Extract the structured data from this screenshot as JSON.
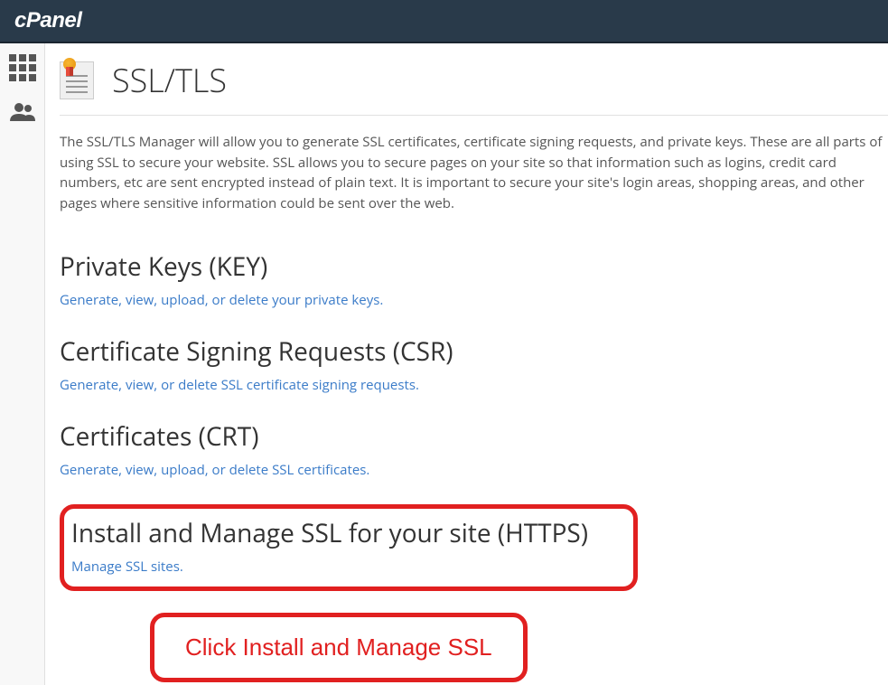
{
  "header": {
    "logo": "cPanel"
  },
  "page": {
    "title": "SSL/TLS",
    "description": "The SSL/TLS Manager will allow you to generate SSL certificates, certificate signing requests, and private keys. These are all parts of using SSL to secure your website. SSL allows you to secure pages on your site so that information such as logins, credit card numbers, etc are sent encrypted instead of plain text. It is important to secure your site's login areas, shopping areas, and other pages where sensitive information could be sent over the web."
  },
  "sections": {
    "privatekeys": {
      "title": "Private Keys (KEY)",
      "link": "Generate, view, upload, or delete your private keys."
    },
    "csr": {
      "title": "Certificate Signing Requests (CSR)",
      "link": "Generate, view, or delete SSL certificate signing requests."
    },
    "crt": {
      "title": "Certificates (CRT)",
      "link": "Generate, view, upload, or delete SSL certificates."
    },
    "install": {
      "title": "Install and Manage SSL for your site (HTTPS)",
      "link": "Manage SSL sites."
    }
  },
  "annotation": {
    "text": "Click Install and Manage SSL"
  }
}
